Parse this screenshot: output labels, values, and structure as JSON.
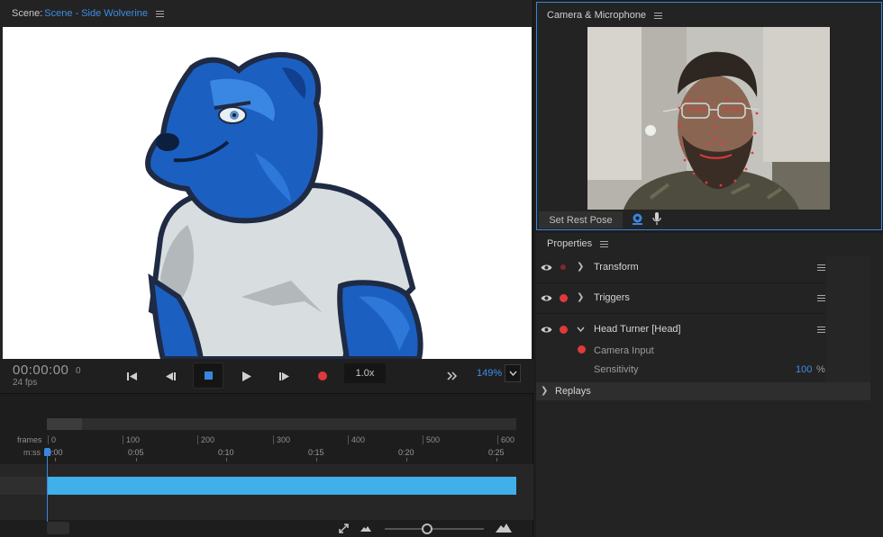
{
  "scene": {
    "title_prefix": "Scene:",
    "title_name": "Scene - Side Wolverine"
  },
  "transport": {
    "timecode": "00:00:00",
    "frame": "0",
    "fps": "24 fps",
    "speed": "1.0x",
    "zoom": "149%",
    "buttons": [
      "go-to-start",
      "step-back",
      "stop",
      "play",
      "step-forward",
      "record",
      "fast-forward"
    ]
  },
  "timeline": {
    "frames_label": "frames",
    "mss_label": "m:ss",
    "frame_ticks": [
      "0",
      "100",
      "200",
      "300",
      "400",
      "500",
      "600"
    ],
    "time_ticks": [
      "0:00",
      "0:05",
      "0:10",
      "0:15",
      "0:20",
      "0:25"
    ]
  },
  "camera": {
    "title": "Camera & Microphone",
    "set_rest_pose": "Set Rest Pose"
  },
  "properties": {
    "title": "Properties",
    "rows": [
      {
        "label": "Transform"
      },
      {
        "label": "Triggers"
      },
      {
        "label": "Head Turner [Head]"
      }
    ],
    "camera_input_label": "Camera Input",
    "sensitivity_label": "Sensitivity",
    "sensitivity_value": "100",
    "sensitivity_unit": "%",
    "replays_label": "Replays"
  },
  "colors": {
    "accent": "#3d8ee6",
    "record": "#e0393b",
    "track": "#3fb0e9",
    "character_blue": "#1b5fc1",
    "shirt": "#d8dee0"
  }
}
